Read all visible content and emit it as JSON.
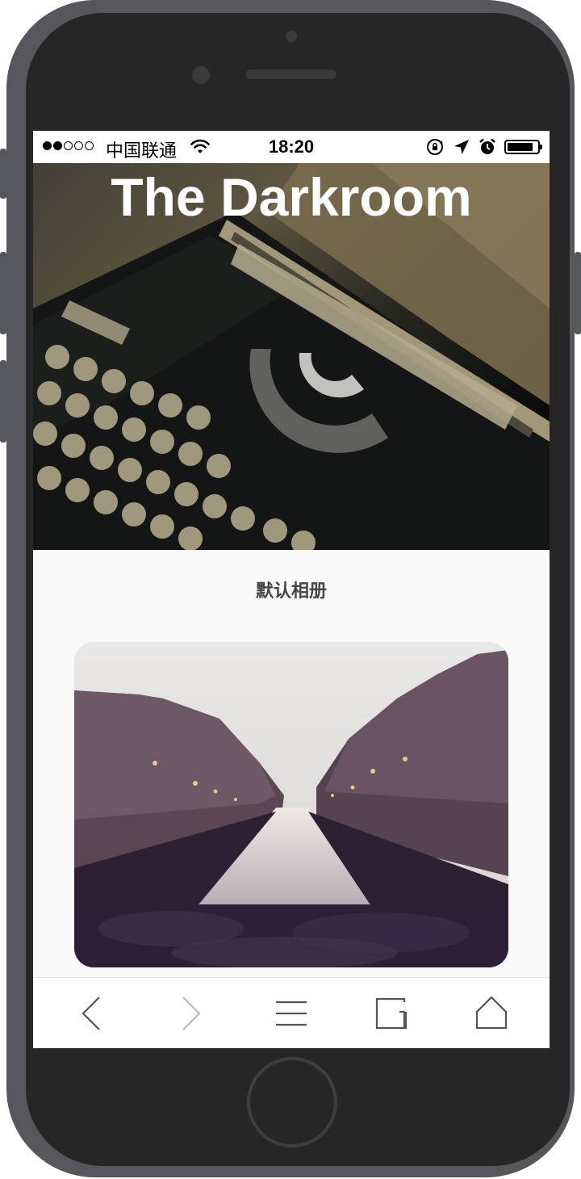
{
  "status_bar": {
    "signal_dots_filled": 2,
    "signal_dots_total": 5,
    "carrier": "中国联通",
    "time": "18:20",
    "battery_level": 0.85,
    "icons": [
      "wifi-icon",
      "orientation-lock-icon",
      "location-arrow-icon",
      "alarm-icon",
      "battery-icon"
    ]
  },
  "hero": {
    "title": "The Darkroom",
    "image": "typewriter-photo"
  },
  "album": {
    "title": "默认相册",
    "photos": [
      {
        "image": "canal-city-photo"
      }
    ]
  },
  "toolbar": {
    "items": [
      {
        "icon": "back-chevron-icon",
        "enabled": true
      },
      {
        "icon": "forward-chevron-icon",
        "enabled": false
      },
      {
        "icon": "menu-icon",
        "enabled": true
      },
      {
        "icon": "tabs-icon",
        "enabled": true
      },
      {
        "icon": "home-icon",
        "enabled": true
      }
    ]
  },
  "colors": {
    "title_text": "#ffffff",
    "album_title_text": "#444444",
    "screen_background": "#fafafa",
    "toolbar_icon": "#555555",
    "toolbar_icon_disabled": "#bbbbbb"
  }
}
